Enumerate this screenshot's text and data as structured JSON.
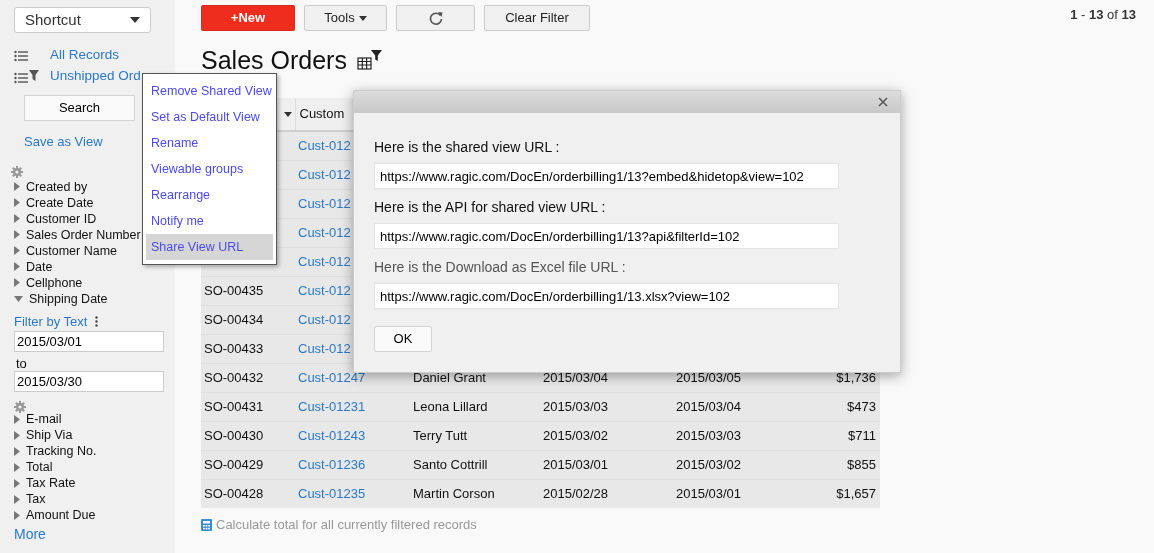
{
  "sidebar": {
    "shortcut": "Shortcut",
    "views": [
      {
        "label": "All Records",
        "filtered": false
      },
      {
        "label": "Unshipped Ord",
        "filtered": true
      }
    ],
    "search_button": "Search",
    "save_view": "Save as View",
    "fields": [
      {
        "label": "Created by",
        "expanded": false
      },
      {
        "label": "Create Date",
        "expanded": false
      },
      {
        "label": "Customer ID",
        "expanded": false
      },
      {
        "label": "Sales Order Number",
        "expanded": false
      },
      {
        "label": "Customer Name",
        "expanded": false
      },
      {
        "label": "Date",
        "expanded": false
      },
      {
        "label": "Cellphone",
        "expanded": false
      },
      {
        "label": "Shipping Date",
        "expanded": true,
        "filter": {
          "mode": "Filter by Text",
          "from": "2015/03/01",
          "to_label": "to",
          "to": "2015/03/30"
        }
      },
      {
        "label": "E-mail",
        "expanded": false
      },
      {
        "label": "Ship Via",
        "expanded": false
      },
      {
        "label": "Tracking No.",
        "expanded": false
      },
      {
        "label": "Total",
        "expanded": false
      },
      {
        "label": "Tax Rate",
        "expanded": false
      },
      {
        "label": "Tax",
        "expanded": false
      },
      {
        "label": "Amount Due",
        "expanded": false
      }
    ],
    "more": "More"
  },
  "toolbar": {
    "new_button": "+New",
    "tools_button": "Tools",
    "clear_filter": "Clear Filter",
    "pager": "**1** - **13** of **13**"
  },
  "title": "Sales Orders",
  "context_menu": [
    {
      "label": "Remove Shared View",
      "selected": false
    },
    {
      "label": "Set as Default View",
      "selected": false
    },
    {
      "label": "Rename",
      "selected": false
    },
    {
      "label": "Viewable groups",
      "selected": false
    },
    {
      "label": "Rearrange",
      "selected": false
    },
    {
      "label": "Notify me",
      "selected": false
    },
    {
      "label": "Share View URL",
      "selected": true
    }
  ],
  "table": {
    "columns": [
      {
        "sortable": true
      },
      {
        "label": "Custom",
        "sortable": false
      }
    ],
    "rows": [
      {
        "customer": "Cust-012"
      },
      {
        "customer": "Cust-012"
      },
      {
        "customer": "Cust-012"
      },
      {
        "customer": "Cust-012"
      },
      {
        "customer": "Cust-012"
      },
      {
        "order": "SO-00435",
        "customer": "Cust-012"
      },
      {
        "order": "SO-00434",
        "customer": "Cust-012"
      },
      {
        "order": "SO-00433",
        "customer": "Cust-012"
      },
      {
        "order": "SO-00432",
        "customer": "Cust-01247",
        "name": "Daniel Grant",
        "date": "2015/03/04",
        "shipping_date": "2015/03/05",
        "total": "$1,736"
      },
      {
        "order": "SO-00431",
        "customer": "Cust-01231",
        "name": "Leona Lillard",
        "date": "2015/03/03",
        "shipping_date": "2015/03/04",
        "total": "$473"
      },
      {
        "order": "SO-00430",
        "customer": "Cust-01243",
        "name": "Terry Tutt",
        "date": "2015/03/02",
        "shipping_date": "2015/03/03",
        "total": "$711"
      },
      {
        "order": "SO-00429",
        "customer": "Cust-01236",
        "name": "Santo Cottrill",
        "date": "2015/03/01",
        "shipping_date": "2015/03/02",
        "total": "$855"
      },
      {
        "order": "SO-00428",
        "customer": "Cust-01235",
        "name": "Martin Corson",
        "date": "2015/02/28",
        "shipping_date": "2015/03/01",
        "total": "$1,657"
      }
    ],
    "footer": "Calculate total for all currently filtered records"
  },
  "dialog": {
    "fields": [
      {
        "label": "Here is the shared view URL :",
        "value": "https://www.ragic.com/DocEn/orderbilling1/13?embed&hidetop&view=102"
      },
      {
        "label": "Here is the API for shared view URL :",
        "value": "https://www.ragic.com/DocEn/orderbilling1/13?api&filterId=102"
      },
      {
        "label": "Here is the Download as Excel file URL :",
        "value": "https://www.ragic.com/DocEn/orderbilling1/13.xlsx?view=102"
      }
    ],
    "ok_button": "OK"
  }
}
